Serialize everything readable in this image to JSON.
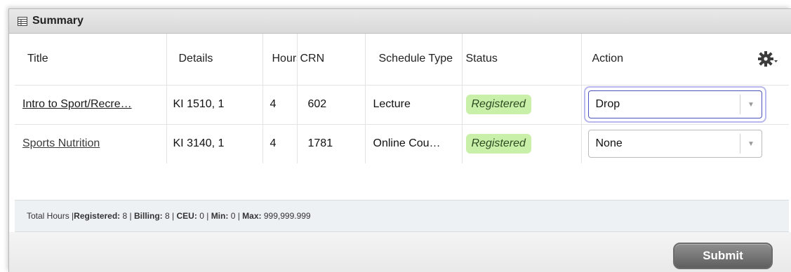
{
  "panel": {
    "title": "Summary",
    "icon": "table-icon"
  },
  "columns": [
    "Title",
    "Details",
    "Hours",
    "CRN",
    "Schedule Type",
    "Status",
    "Action"
  ],
  "rows": [
    {
      "title": "Intro to Sport/Recre…",
      "details": "KI 1510, 1",
      "hours": "4",
      "crn": "602",
      "schedule_type": "Lecture",
      "status": "Registered",
      "action": "Drop"
    },
    {
      "title": "Sports Nutrition",
      "details": "KI 3140, 1",
      "hours": "4",
      "crn": "1781",
      "schedule_type": "Online Cou…",
      "status": "Registered",
      "action": "None"
    }
  ],
  "totals": {
    "prefix": "Total Hours | ",
    "registered_label": "Registered:",
    "registered": "8",
    "billing_label": "Billing:",
    "billing": "8",
    "ceu_label": "CEU:",
    "ceu": "0",
    "min_label": "Min:",
    "min": "0",
    "max_label": "Max:",
    "max": "999,999.999"
  },
  "footer": {
    "submit_label": "Submit"
  },
  "colors": {
    "badge_bg": "#c9f0a8",
    "focus_outline": "#b8b8ee",
    "submit_bg": "#6f6f6f"
  }
}
